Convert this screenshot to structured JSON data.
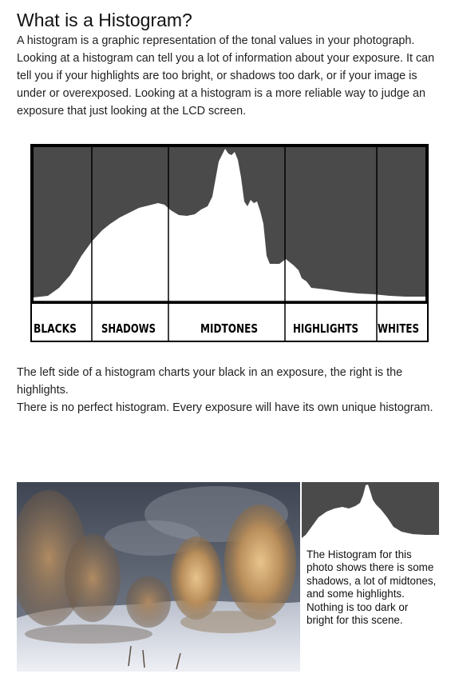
{
  "article": {
    "title": "What is a Histogram?",
    "intro": "A histogram is a graphic representation of the tonal values in your photograph. Looking at a histogram can tell you a lot of information about your exposure. It can tell you if your highlights are too bright, or shadows too dark, or if your image is under or overexposed. Looking at a histogram is a more reliable way to judge an exposure that just looking at the LCD screen.",
    "paragraph_2": "The left side of a histogram charts your black in an exposure, the right is the highlights.",
    "paragraph_3": "There is no perfect histogram. Every exposure will have its own unique histogram."
  },
  "histogram_figure": {
    "zones": [
      "BLACKS",
      "SHADOWS",
      "MIDTONES",
      "HIGHLIGHTS",
      "WHITES"
    ],
    "colors": {
      "frame": "#000000",
      "background": "#4a4a4a",
      "fill": "#ffffff"
    }
  },
  "photo_figure": {
    "caption": "The Histogram for this photo shows there is some shadows, a lot of midtones, and some highlights. Nothing is too dark or bright for this scene.",
    "colors": {
      "sky": "#4f5562",
      "snow": "#e6e9f0",
      "trees": "#c8a474",
      "histogram_bg": "#4a4a4a"
    }
  }
}
